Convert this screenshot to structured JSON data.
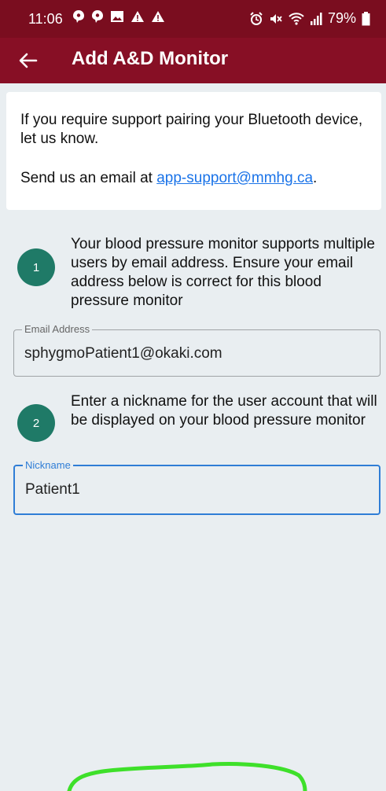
{
  "status_bar": {
    "time": "11:06",
    "battery": "79%"
  },
  "app_bar": {
    "title": "Add A&D Monitor"
  },
  "info": {
    "support_text": "If you require support pairing your Bluetooth device, let us know.",
    "email_prefix": "Send us an email at ",
    "email_link": "app-support@mmhg.ca",
    "email_suffix": "."
  },
  "steps": [
    {
      "number": "1",
      "text": "Your blood pressure monitor supports multiple users by email address. Ensure your email address below is correct for this blood pressure monitor"
    },
    {
      "number": "2",
      "text": "Enter a nickname for the user account that will be displayed on your blood pressure monitor"
    }
  ],
  "fields": {
    "email": {
      "label": "Email Address",
      "value": "sphygmoPatient1@okaki.com"
    },
    "nickname": {
      "label": "Nickname",
      "value": "Patient1"
    }
  },
  "colors": {
    "status_bar": "#7a0d1f",
    "app_bar": "#870f25",
    "step_circle": "#1f7a67",
    "focus": "#2f7dd6",
    "link": "#1a73e8",
    "annotation": "#3ee02a"
  },
  "icons": {
    "back": "arrow-left-icon",
    "status_left": [
      "message-icon",
      "message-icon",
      "image-icon",
      "warning-icon",
      "warning-icon"
    ],
    "status_right": [
      "alarm-icon",
      "mute-icon",
      "wifi-icon",
      "signal-icon",
      "battery-icon"
    ]
  }
}
